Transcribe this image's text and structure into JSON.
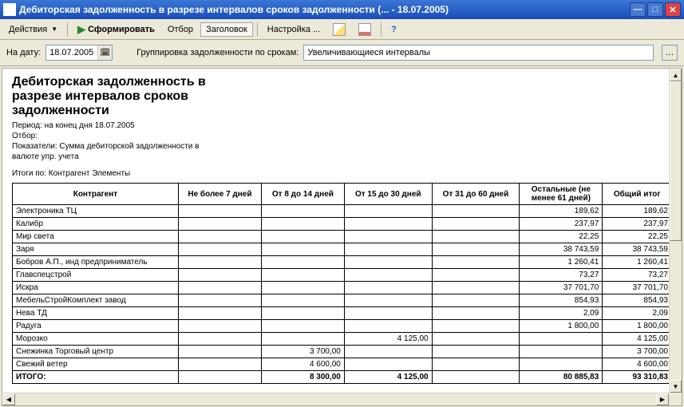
{
  "window": {
    "title": "Дебиторская задолженность в разрезе интервалов сроков задолженности (... - 18.07.2005)"
  },
  "toolbar": {
    "actions_label": "Действия",
    "form_label": "Сформировать",
    "filter_label": "Отбор",
    "header_label": "Заголовок",
    "settings_label": "Настройка ..."
  },
  "controls": {
    "date_label": "На дату:",
    "date_value": "18.07.2005",
    "group_label": "Группировка задолженности по срокам:",
    "group_value": "Увеличивающиеся интервалы"
  },
  "report": {
    "title_l1": "Дебиторская задолженность в",
    "title_l2": "разрезе интервалов сроков",
    "title_l3": "задолженности",
    "period": "Период: на конец дня 18.07.2005",
    "filter": "Отбор:",
    "indicators_l1": "Показатели:  Сумма дебиторской задолженности в",
    "indicators_l2": "валюте упр. учета",
    "totals_by": "Итоги по:  Контрагент Элементы"
  },
  "columns": {
    "c0": "Контрагент",
    "c1": "Не более 7 дней",
    "c2": "От 8 до 14 дней",
    "c3": "От 15 до 30 дней",
    "c4": "От 31 до 60 дней",
    "c5_l1": "Остальные (не",
    "c5_l2": "менее 61 дней)",
    "c6": "Общий итог"
  },
  "rows": [
    {
      "name": "Электроника ТЦ",
      "c1": "",
      "c2": "",
      "c3": "",
      "c4": "",
      "c5": "189,62",
      "c6": "189,62"
    },
    {
      "name": "Калибр",
      "c1": "",
      "c2": "",
      "c3": "",
      "c4": "",
      "c5": "237,97",
      "c6": "237,97"
    },
    {
      "name": "Мир света",
      "c1": "",
      "c2": "",
      "c3": "",
      "c4": "",
      "c5": "22,25",
      "c6": "22,25"
    },
    {
      "name": "Заря",
      "c1": "",
      "c2": "",
      "c3": "",
      "c4": "",
      "c5": "38 743,59",
      "c6": "38 743,59"
    },
    {
      "name": "Бобров А.П., инд предприниматель",
      "c1": "",
      "c2": "",
      "c3": "",
      "c4": "",
      "c5": "1 260,41",
      "c6": "1 260,41"
    },
    {
      "name": "Главспецстрой",
      "c1": "",
      "c2": "",
      "c3": "",
      "c4": "",
      "c5": "73,27",
      "c6": "73,27"
    },
    {
      "name": "Искра",
      "c1": "",
      "c2": "",
      "c3": "",
      "c4": "",
      "c5": "37 701,70",
      "c6": "37 701,70"
    },
    {
      "name": "МебельСтройКомплект завод",
      "c1": "",
      "c2": "",
      "c3": "",
      "c4": "",
      "c5": "854,93",
      "c6": "854,93"
    },
    {
      "name": "Нева ТД",
      "c1": "",
      "c2": "",
      "c3": "",
      "c4": "",
      "c5": "2,09",
      "c6": "2,09"
    },
    {
      "name": "Радуга",
      "c1": "",
      "c2": "",
      "c3": "",
      "c4": "",
      "c5": "1 800,00",
      "c6": "1 800,00"
    },
    {
      "name": "Морозко",
      "c1": "",
      "c2": "",
      "c3": "4 125,00",
      "c4": "",
      "c5": "",
      "c6": "4 125,00"
    },
    {
      "name": "Снежинка Торговый центр",
      "c1": "",
      "c2": "3 700,00",
      "c3": "",
      "c4": "",
      "c5": "",
      "c6": "3 700,00"
    },
    {
      "name": "Свежий ветер",
      "c1": "",
      "c2": "4 600,00",
      "c3": "",
      "c4": "",
      "c5": "",
      "c6": "4 600,00"
    }
  ],
  "total": {
    "name": "ИТОГО:",
    "c1": "",
    "c2": "8 300,00",
    "c3": "4 125,00",
    "c4": "",
    "c5": "80 885,83",
    "c6": "93 310,83"
  }
}
